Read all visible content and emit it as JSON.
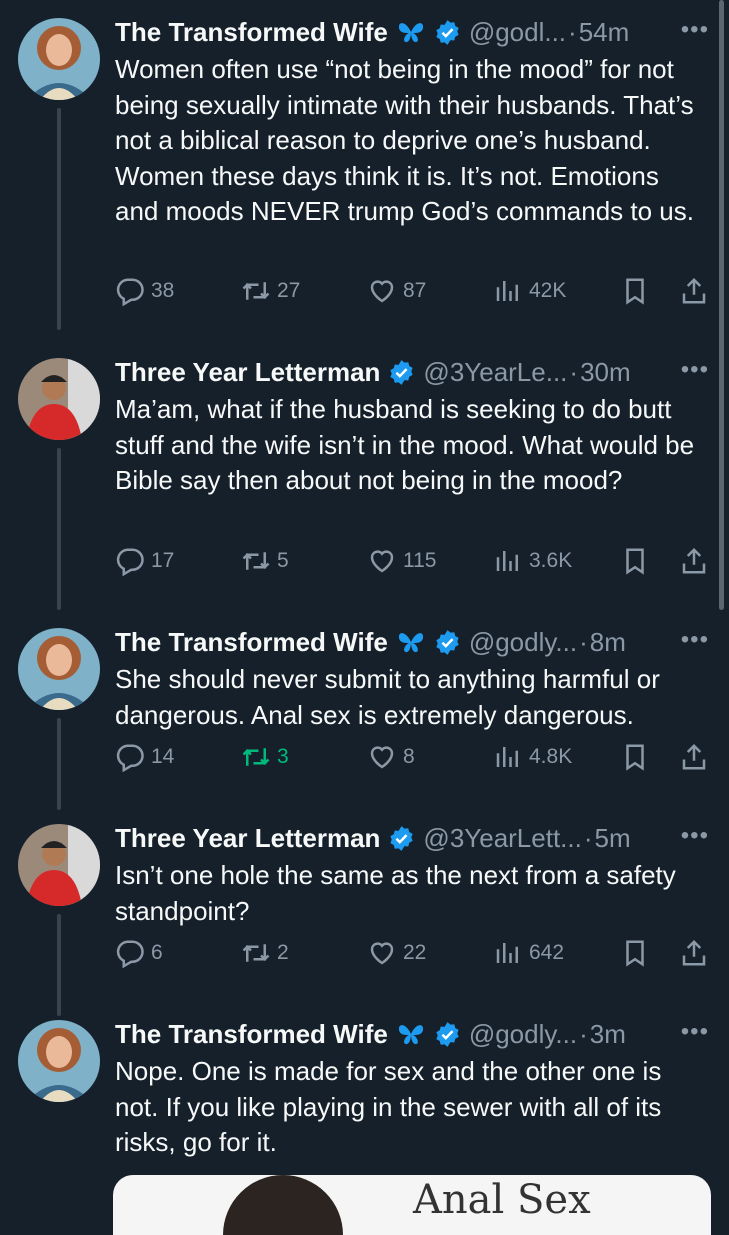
{
  "tweets": [
    {
      "name": "The Transformed Wife",
      "butterfly": true,
      "handle": "@godl...",
      "time": "54m",
      "text": "Women often use “not being in the mood” for not being sexually intimate with their husbands. That’s not a biblical reason to deprive one’s husband. Women these days think it is. It’s not. Emotions and moods NEVER trump God’s commands to us.",
      "replies": "38",
      "retweets": "27",
      "likes": "87",
      "views": "42K"
    },
    {
      "name": "Three Year Letterman",
      "butterfly": false,
      "handle": "@3YearLe...",
      "time": "30m",
      "text": "Ma’am, what if the husband is seeking to do butt stuff and the wife isn’t in the mood. What would be Bible say then about not being in the mood?",
      "replies": "17",
      "retweets": "5",
      "likes": "115",
      "views": "3.6K"
    },
    {
      "name": "The Transformed Wife",
      "butterfly": true,
      "handle": "@godly...",
      "time": "8m",
      "text": "She should never submit to anything harmful or dangerous. Anal sex is extremely dangerous.",
      "replies": "14",
      "retweets": "3",
      "likes": "8",
      "views": "4.8K"
    },
    {
      "name": "Three Year Letterman",
      "butterfly": false,
      "handle": "@3YearLett...",
      "time": "5m",
      "text": "Isn’t one hole the same as the next from a safety standpoint?",
      "replies": "6",
      "retweets": "2",
      "likes": "22",
      "views": "642"
    },
    {
      "name": "The Transformed Wife",
      "butterfly": true,
      "handle": "@godly...",
      "time": "3m",
      "text": "Nope. One is made for sex and the other one is not. If you like playing in the sewer with all of its risks, go for it."
    }
  ],
  "separator": "·",
  "more_label": "•••",
  "card_text": "Anal Sex",
  "colors": {
    "background": "#15202b",
    "muted": "#8b98a5",
    "verified": "#1d9bf0",
    "butterfly": "#1d9bf0",
    "retweeted": "#00ba7c"
  }
}
